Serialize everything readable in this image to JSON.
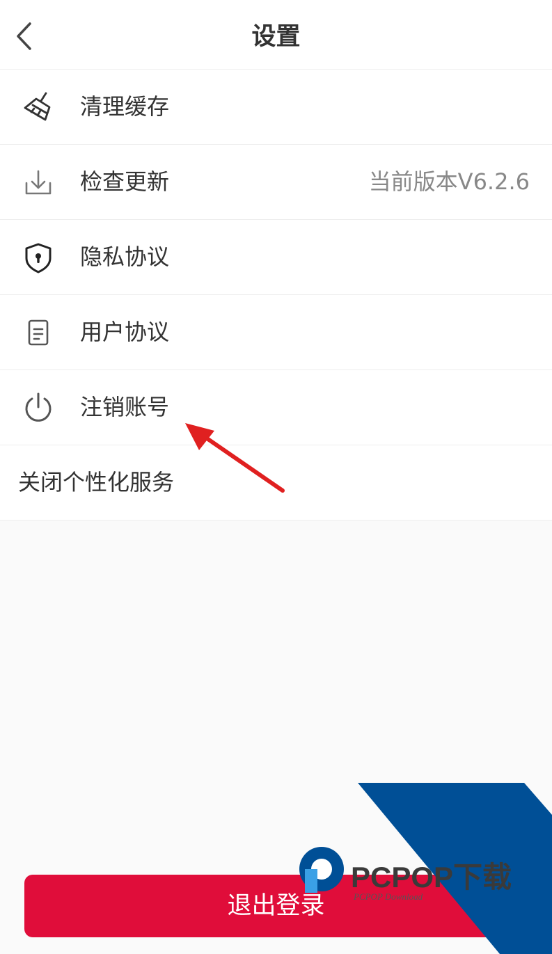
{
  "header": {
    "title": "设置",
    "back_icon": "chevron-left-icon"
  },
  "menu": {
    "items": [
      {
        "label": "清理缓存",
        "icon": "broom-icon"
      },
      {
        "label": "检查更新",
        "icon": "download-icon",
        "value": "当前版本V6.2.6"
      },
      {
        "label": "隐私协议",
        "icon": "shield-lock-icon"
      },
      {
        "label": "用户协议",
        "icon": "document-icon"
      },
      {
        "label": "注销账号",
        "icon": "power-icon"
      },
      {
        "label": "关闭个性化服务"
      }
    ]
  },
  "logout": {
    "label": "退出登录"
  },
  "watermark": {
    "brand": "PCPOP下载",
    "sub": "PCPOP Download"
  },
  "colors": {
    "accent": "#e00d3a",
    "annotation": "#e02020",
    "watermark_blue": "#004f96"
  }
}
